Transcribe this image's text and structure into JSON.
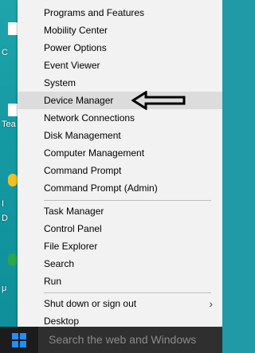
{
  "desktop": {
    "labels": [
      "C",
      "Tea",
      "I",
      "D",
      "μ"
    ]
  },
  "menu": {
    "group1": [
      "Programs and Features",
      "Mobility Center",
      "Power Options",
      "Event Viewer",
      "System",
      "Device Manager",
      "Network Connections",
      "Disk Management",
      "Computer Management",
      "Command Prompt",
      "Command Prompt (Admin)"
    ],
    "group2": [
      "Task Manager",
      "Control Panel",
      "File Explorer",
      "Search",
      "Run"
    ],
    "group3": [
      "Shut down or sign out",
      "Desktop"
    ],
    "highlighted": "Device Manager"
  },
  "taskbar": {
    "search_placeholder": "Search the web and Windows"
  },
  "colors": {
    "menu_bg": "#f2f2f2",
    "highlight_bg": "#dcdcdc",
    "taskbar_bg": "#1c1c1c",
    "start_logo": "#1e90ff"
  },
  "icons": {
    "start": "windows-logo-icon",
    "submenu": "chevron-right-icon",
    "annotation": "arrow-left-icon"
  }
}
